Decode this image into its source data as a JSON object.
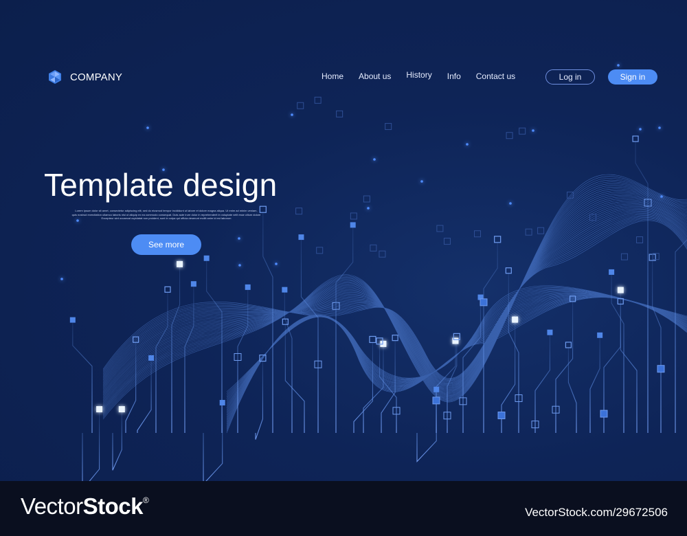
{
  "header": {
    "logo_text": "COMPANY",
    "logo_icon": "hexagon-triangles-icon",
    "nav": [
      "Home",
      "About us",
      "History",
      "Info",
      "Contact us"
    ],
    "login_label": "Log in",
    "signin_label": "Sign in"
  },
  "hero": {
    "title": "Template design",
    "body_lines": [
      "Lorem ipsum dolor sit amet, consectetur adipiscing elit, sed do eiusmod tempor incididunt ut labore et dolore magna aliqua. Ut enim ad minim veniam,",
      "quis nostrud exercitation ullamco laboris nisi ut aliquip ex ea commodo consequat. Duis aute irure dolor in reprehenderit in voluptate velit esse cillum dolore",
      "Excepteur sint occaecat cupidatat non proident, sunt in culpa qui officia deserunt mollit anim id est laborum"
    ],
    "cta_label": "See more"
  },
  "watermark": {
    "brand_light": "Vector",
    "brand_bold": "Stock",
    "registered": "®",
    "image_id": "VectorStock.com/29672506"
  },
  "colors": {
    "background": "#0d2150",
    "accent": "#4d8cf4",
    "circuit_line": "#5f8fe6",
    "node_glow": "#e8f3ff",
    "footer": "#0a0f1f"
  }
}
